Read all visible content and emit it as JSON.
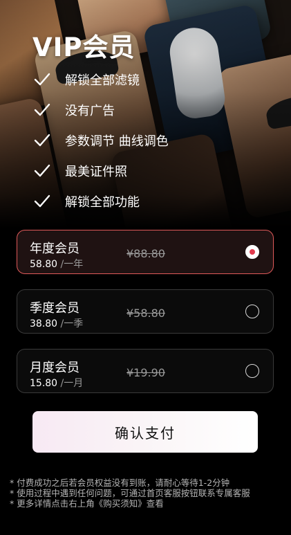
{
  "title": "VIP会员",
  "features": [
    "解锁全部滤镜",
    "没有广告",
    "参数调节 曲线调色",
    "最美证件照",
    "解锁全部功能"
  ],
  "plans": [
    {
      "name": "年度会员",
      "price": "58.80",
      "unit": "/一年",
      "original": "¥88.80",
      "selected": true
    },
    {
      "name": "季度会员",
      "price": "38.80",
      "unit": "/一季",
      "original": "¥58.80",
      "selected": false
    },
    {
      "name": "月度会员",
      "price": "15.80",
      "unit": "/一月",
      "original": "¥19.90",
      "selected": false
    }
  ],
  "confirm_label": "确认支付",
  "notes": [
    "* 付费成功之后若会员权益没有到账，请耐心等待1-2分钟",
    "* 使用过程中遇到任何问题，可通过首页客服按钮联系专属客服",
    "* 更多详情点击右上角《购买须知》查看"
  ],
  "colors": {
    "accent": "#e23b4e",
    "selected_border": "#e05a5a",
    "background": "#000000"
  }
}
